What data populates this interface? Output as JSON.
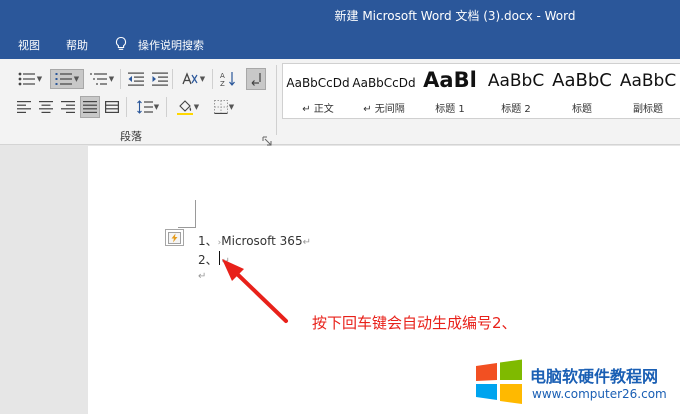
{
  "window": {
    "title": "新建 Microsoft Word 文档 (3).docx  -  Word"
  },
  "menu": {
    "tabs": [
      "视图",
      "帮助"
    ],
    "tell_me": "操作说明搜索"
  },
  "ribbon": {
    "paragraph_group_label": "段落",
    "styles": [
      {
        "preview": "AaBbCcDd",
        "name": "↵ 正文"
      },
      {
        "preview": "AaBbCcDd",
        "name": "↵ 无间隔"
      },
      {
        "preview": "AaBl",
        "name": "标题 1"
      },
      {
        "preview": "AaBbC",
        "name": "标题 2"
      },
      {
        "preview": "AaBbC",
        "name": "标题"
      },
      {
        "preview": "AaBbC",
        "name": "副标题"
      }
    ]
  },
  "document": {
    "lines": [
      {
        "number": "1、",
        "text": "Microsoft 365",
        "mark": "↵"
      },
      {
        "number": "2、",
        "text": "",
        "mark": "↵"
      },
      {
        "number": "",
        "text": "",
        "mark": "↵"
      }
    ]
  },
  "annotation": {
    "text": "按下回车键会自动生成编号2、"
  },
  "watermark": {
    "name": "电脑软硬件教程网",
    "url": "www.computer26.com"
  },
  "colors": {
    "accent": "#2b579a",
    "annotation": "#e8211a",
    "watermark": "#1a5fb4"
  }
}
